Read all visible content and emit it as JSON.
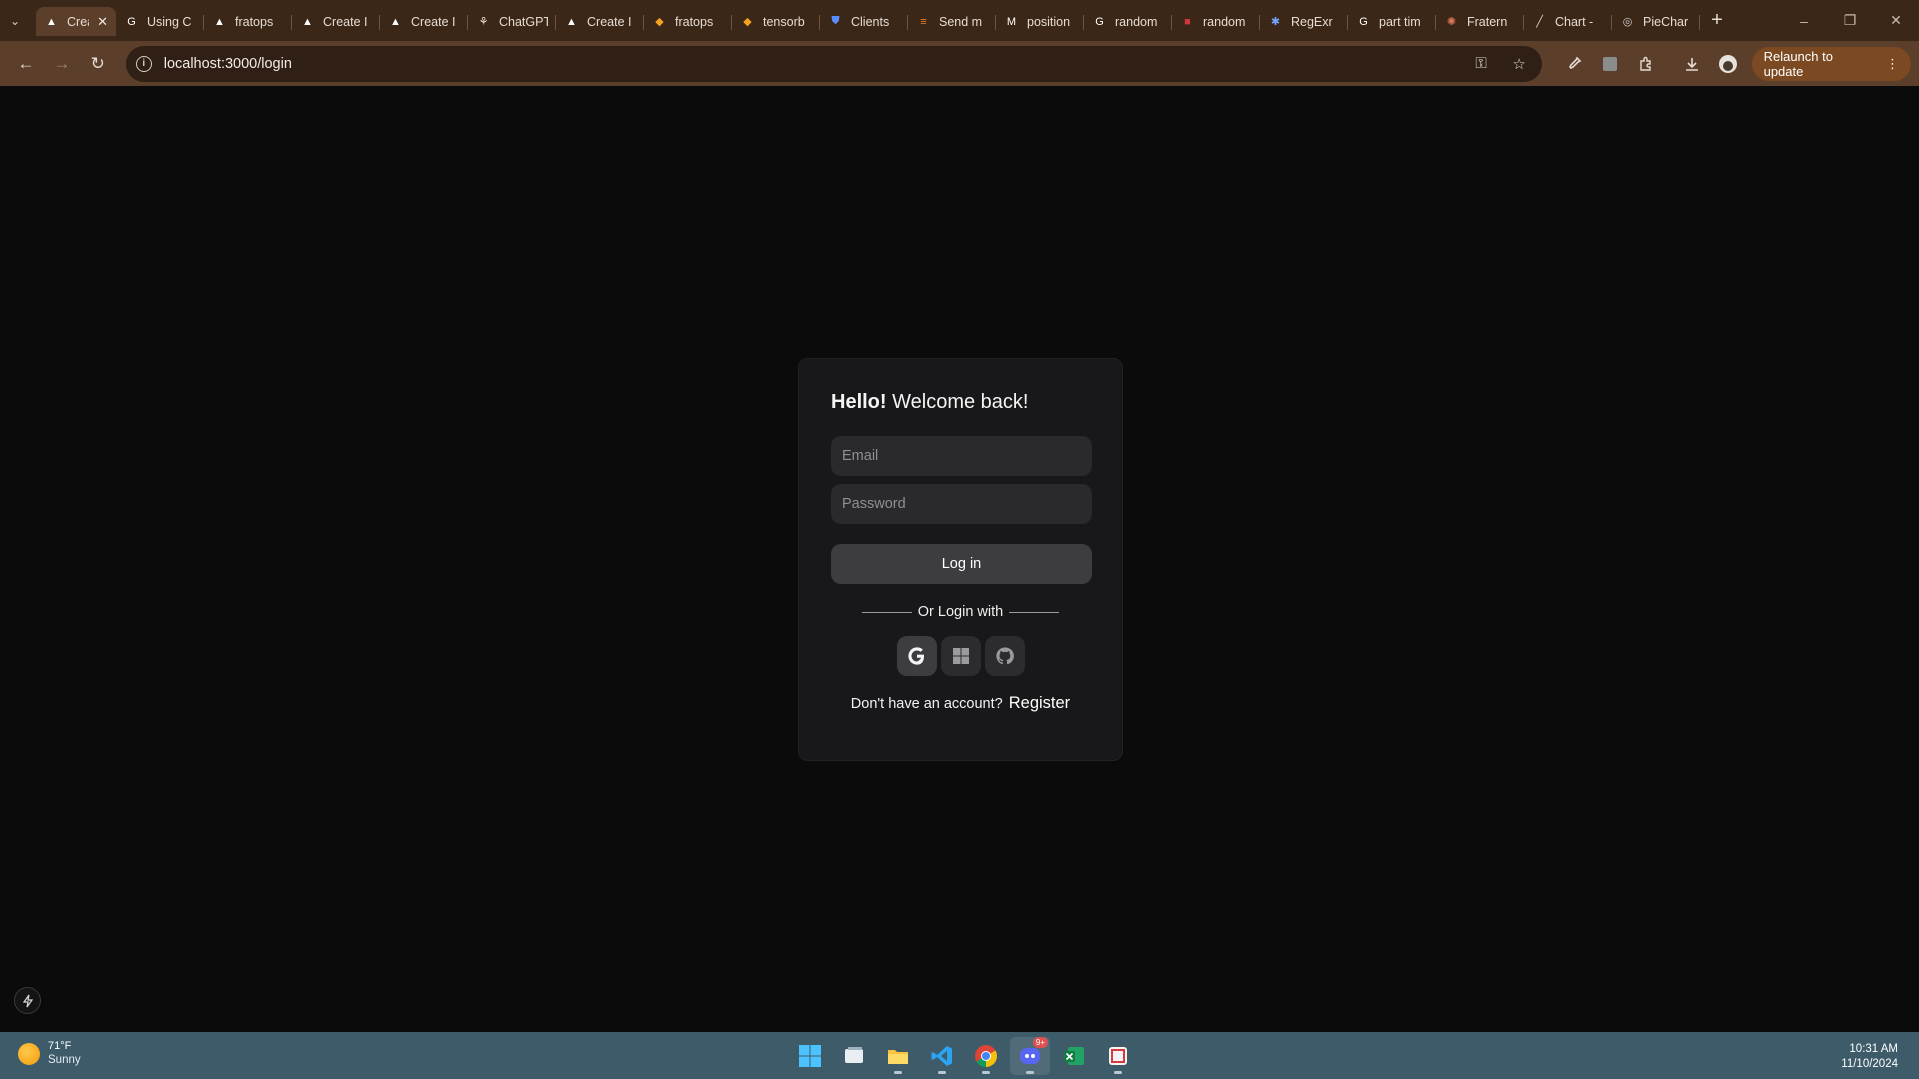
{
  "browser": {
    "tabs": [
      {
        "title": "Create",
        "favicon": "triangle-icon",
        "active": true
      },
      {
        "title": "Using C",
        "favicon": "google-icon"
      },
      {
        "title": "fratops",
        "favicon": "triangle-icon"
      },
      {
        "title": "Create I",
        "favicon": "triangle-icon"
      },
      {
        "title": "Create I",
        "favicon": "triangle-icon"
      },
      {
        "title": "ChatGPT",
        "favicon": "chatgpt-icon"
      },
      {
        "title": "Create I",
        "favicon": "triangle-icon"
      },
      {
        "title": "fratops",
        "favicon": "firebase-icon"
      },
      {
        "title": "tensorb",
        "favicon": "firebase-icon"
      },
      {
        "title": "Clients",
        "favicon": "shield-icon"
      },
      {
        "title": "Send m",
        "favicon": "stack-icon"
      },
      {
        "title": "position",
        "favicon": "medium-icon"
      },
      {
        "title": "random",
        "favicon": "google-icon"
      },
      {
        "title": "random",
        "favicon": "npm-icon"
      },
      {
        "title": "RegExr",
        "favicon": "regexr-icon"
      },
      {
        "title": "part tim",
        "favicon": "google-icon"
      },
      {
        "title": "Fratern",
        "favicon": "claude-icon"
      },
      {
        "title": "Chart -",
        "favicon": "chart-icon"
      },
      {
        "title": "PieChar",
        "favicon": "globe-icon"
      }
    ],
    "url": "localhost:3000/login",
    "relaunch_label": "Relaunch to update"
  },
  "login": {
    "greeting_bold": "Hello!",
    "greeting_rest": " Welcome back!",
    "email_placeholder": "Email",
    "password_placeholder": "Password",
    "login_button": "Log in",
    "divider_text": "Or Login with",
    "no_account_text": "Don't have an account?",
    "register_link": "Register"
  },
  "taskbar": {
    "temperature": "71°F",
    "condition": "Sunny",
    "time": "10:31 AM",
    "date": "11/10/2024",
    "discord_badge": "9+"
  }
}
